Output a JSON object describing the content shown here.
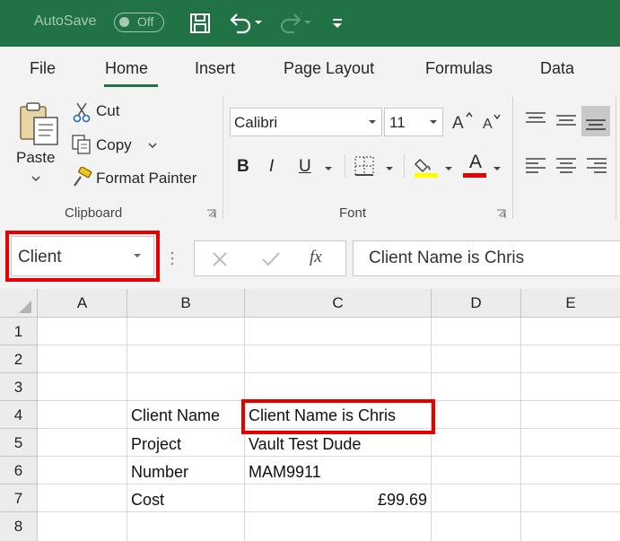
{
  "titlebar": {
    "autosave_label": "AutoSave",
    "autosave_state": "Off"
  },
  "tabs": [
    {
      "label": "File"
    },
    {
      "label": "Home"
    },
    {
      "label": "Insert"
    },
    {
      "label": "Page Layout"
    },
    {
      "label": "Formulas"
    },
    {
      "label": "Data"
    }
  ],
  "clipboard": {
    "paste_label": "Paste",
    "cut_label": "Cut",
    "copy_label": "Copy",
    "format_painter_label": "Format Painter",
    "group_label": "Clipboard"
  },
  "font": {
    "font_name": "Calibri",
    "font_size": "11",
    "bold_label": "B",
    "italic_label": "I",
    "underline_label": "U",
    "font_color_glyph": "A",
    "group_label": "Font",
    "highlight_color": "#ffff00",
    "font_color": "#e60000"
  },
  "formula_bar": {
    "name_box": "Client",
    "fx_label": "fx",
    "formula": "Client Name is Chris"
  },
  "grid": {
    "columns": [
      "A",
      "B",
      "C",
      "D",
      "E"
    ],
    "rows": [
      "1",
      "2",
      "3",
      "4",
      "5",
      "6",
      "7",
      "8"
    ],
    "cells": {
      "B4": "Client Name",
      "C4": "Client Name is Chris",
      "B5": "Project",
      "C5": "Vault Test Dude",
      "B6": "Number",
      "C6": "MAM9911",
      "B7": "Cost",
      "C7": "£99.69"
    }
  },
  "colors": {
    "brand_green": "#217346",
    "highlight_red": "#e60000"
  }
}
